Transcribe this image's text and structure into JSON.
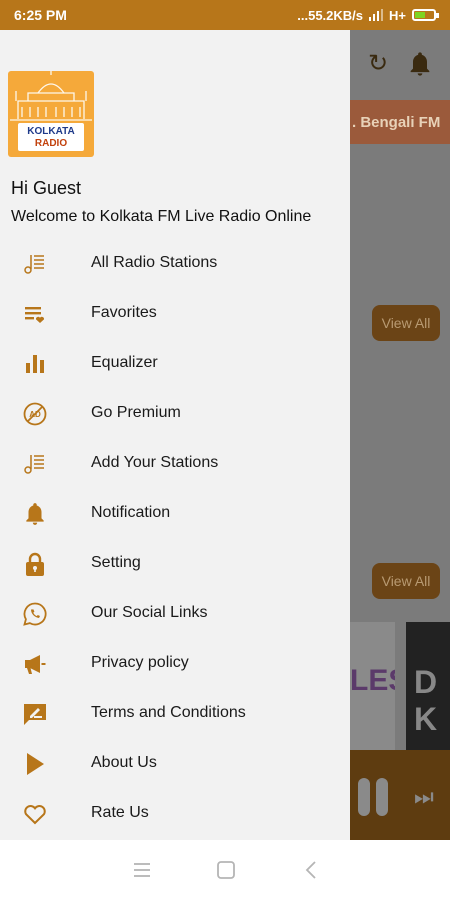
{
  "status_bar": {
    "time": "6:25 PM",
    "network": "...55.2KB/s",
    "signal_text": "H+"
  },
  "background_app": {
    "chip_text": ". Bengali FM",
    "view_all_1": "View All",
    "view_all_2": "View All",
    "card1_text": "LES",
    "card2_text": "D K"
  },
  "drawer": {
    "logo": {
      "line1": "KOLKATA",
      "line2": "RADIO"
    },
    "greeting": "Hi Guest",
    "welcome": "Welcome to Kolkata FM Live Radio Online",
    "items": [
      {
        "label": "All Radio Stations",
        "icon": "music-list-icon"
      },
      {
        "label": "Favorites",
        "icon": "playlist-heart-icon"
      },
      {
        "label": "Equalizer",
        "icon": "equalizer-icon"
      },
      {
        "label": "Go Premium",
        "icon": "no-ads-icon"
      },
      {
        "label": "Add Your Stations",
        "icon": "music-list-icon"
      },
      {
        "label": "Notification",
        "icon": "bell-icon"
      },
      {
        "label": "Setting",
        "icon": "lock-icon"
      },
      {
        "label": "Our Social Links",
        "icon": "whatsapp-icon"
      },
      {
        "label": "Privacy policy",
        "icon": "megaphone-icon"
      },
      {
        "label": "Terms and Conditions",
        "icon": "edit-icon"
      },
      {
        "label": "About Us",
        "icon": "play-icon"
      },
      {
        "label": "Rate Us",
        "icon": "heart-icon"
      }
    ]
  },
  "colors": {
    "accent": "#B7761A",
    "status_bar": "#B7761A",
    "drawer_bg": "#F2F2F2",
    "logo_bg": "#F5A93A"
  }
}
